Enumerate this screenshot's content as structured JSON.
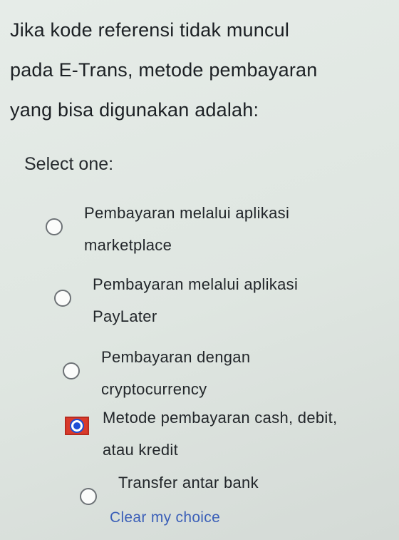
{
  "question": {
    "line1": "Jika kode referensi tidak muncul",
    "line2": "pada E-Trans, metode pembayaran",
    "line3": "yang bisa digunakan adalah:"
  },
  "select_label": "Select one:",
  "options": [
    {
      "line1": "Pembayaran melalui aplikasi",
      "line2": "marketplace",
      "selected": false
    },
    {
      "line1": "Pembayaran melalui aplikasi",
      "line2": "PayLater",
      "selected": false
    },
    {
      "line1": "Pembayaran dengan",
      "line2": "cryptocurrency",
      "selected": false
    },
    {
      "line1": "Metode pembayaran cash, debit,",
      "line2": "atau kredit",
      "selected": true
    },
    {
      "line1": "Transfer antar bank",
      "line2": "",
      "selected": false
    }
  ],
  "clear_choice_label": "Clear my choice",
  "colors": {
    "radio_selected": "#1d4fd6",
    "selected_highlight": "#d93a2b",
    "link": "#3b5fb8"
  }
}
